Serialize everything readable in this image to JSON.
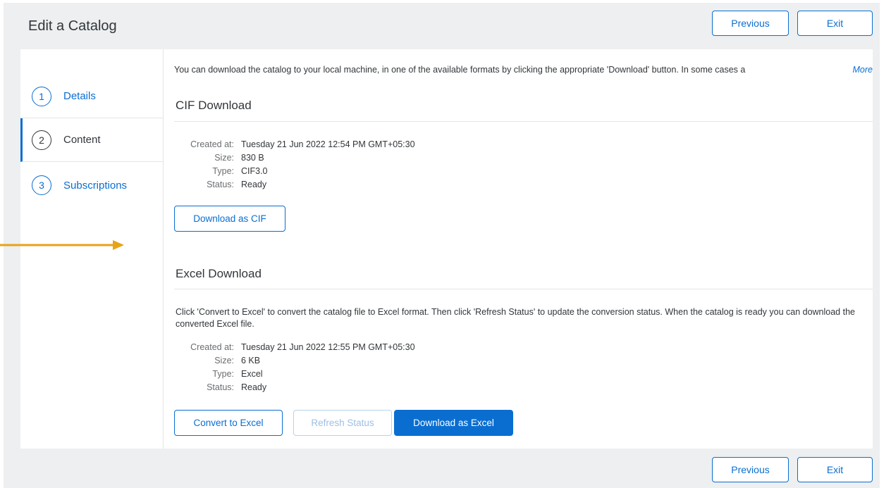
{
  "header": {
    "title": "Edit a Catalog",
    "previous_label": "Previous",
    "exit_label": "Exit"
  },
  "footer": {
    "previous_label": "Previous",
    "exit_label": "Exit"
  },
  "sidebar": {
    "steps": [
      {
        "number": "1",
        "label": "Details",
        "state": "link"
      },
      {
        "number": "2",
        "label": "Content",
        "state": "active"
      },
      {
        "number": "3",
        "label": "Subscriptions",
        "state": "link"
      }
    ]
  },
  "content": {
    "intro": "You can download the catalog to your local machine, in one of the available formats by clicking the appropriate 'Download' button. In some cases a",
    "more_link": "More",
    "cif": {
      "title": "CIF Download",
      "meta": [
        {
          "key": "Created at:",
          "value": "Tuesday 21 Jun 2022 12:54 PM GMT+05:30"
        },
        {
          "key": "Size:",
          "value": "830 B"
        },
        {
          "key": "Type:",
          "value": "CIF3.0"
        },
        {
          "key": "Status:",
          "value": "Ready"
        }
      ],
      "download_label": "Download as CIF"
    },
    "excel": {
      "title": "Excel Download",
      "description": "Click 'Convert to Excel' to convert the catalog file to Excel format. Then click 'Refresh Status' to update the conversion status. When the catalog is ready you can download the converted Excel file.",
      "meta": [
        {
          "key": "Created at:",
          "value": "Tuesday 21 Jun 2022 12:55 PM GMT+05:30"
        },
        {
          "key": "Size:",
          "value": "6 KB"
        },
        {
          "key": "Type:",
          "value": "Excel"
        },
        {
          "key": "Status:",
          "value": "Ready"
        }
      ],
      "convert_label": "Convert to Excel",
      "refresh_label": "Refresh Status",
      "download_label": "Download as Excel"
    }
  },
  "annotation": {
    "icon": "arrow-right-icon",
    "color": "#e8a317"
  },
  "colors": {
    "accent": "#0a6ed1",
    "background": "#edeff0"
  }
}
